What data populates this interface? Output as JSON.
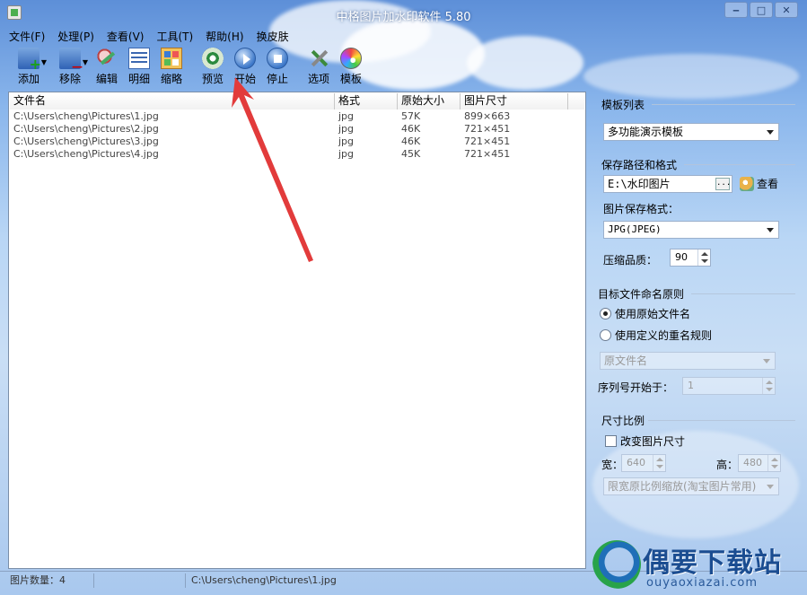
{
  "window": {
    "title": "中格图片加水印软件 5.80",
    "controls": [
      "minimize",
      "maximize",
      "close"
    ]
  },
  "menu": [
    "文件(F)",
    "处理(P)",
    "查看(V)",
    "工具(T)",
    "帮助(H)",
    "换皮肤"
  ],
  "toolbar": {
    "add": "添加",
    "remove": "移除",
    "edit": "编辑",
    "detail": "明细",
    "thumbnail": "缩略",
    "preview": "预览",
    "start": "开始",
    "stop": "停止",
    "options": "选项",
    "template": "模板"
  },
  "file_list": {
    "columns": [
      "文件名",
      "格式",
      "原始大小",
      "图片尺寸"
    ],
    "rows": [
      {
        "name": "C:\\Users\\cheng\\Pictures\\1.jpg",
        "format": "jpg",
        "size": "57K",
        "dimensions": "899×663"
      },
      {
        "name": "C:\\Users\\cheng\\Pictures\\2.jpg",
        "format": "jpg",
        "size": "46K",
        "dimensions": "721×451"
      },
      {
        "name": "C:\\Users\\cheng\\Pictures\\3.jpg",
        "format": "jpg",
        "size": "46K",
        "dimensions": "721×451"
      },
      {
        "name": "C:\\Users\\cheng\\Pictures\\4.jpg",
        "format": "jpg",
        "size": "45K",
        "dimensions": "721×451"
      }
    ]
  },
  "panel": {
    "template_section": "模板列表",
    "template_value": "多功能演示模板",
    "save_section": "保存路径和格式",
    "save_path": "E:\\水印图片",
    "browse": "...",
    "view_label": "查看",
    "format_label": "图片保存格式：",
    "format_value": "JPG(JPEG)",
    "quality_label": "压缩品质：",
    "quality_value": "90",
    "naming_section": "目标文件命名原则",
    "naming_original": "使用原始文件名",
    "naming_custom": "使用定义的重名规则",
    "naming_pattern": "原文件名",
    "seq_label": "序列号开始于：",
    "seq_value": "1",
    "size_section": "尺寸比例",
    "resize_label": "改变图片尺寸",
    "width_label": "宽：",
    "width_value": "640",
    "height_label": "高：",
    "height_value": "480",
    "scale_mode": "限宽原比例缩放(淘宝图片常用)"
  },
  "status": {
    "count": "图片数量：4",
    "current": "C:\\Users\\cheng\\Pictures\\1.jpg"
  },
  "watermark": {
    "name": "偶要下载站",
    "url": "ouyaoxiazai.com"
  },
  "colors": {
    "annotation_arrow": "#e23b3b",
    "watermark_text": "#1b4d91"
  }
}
